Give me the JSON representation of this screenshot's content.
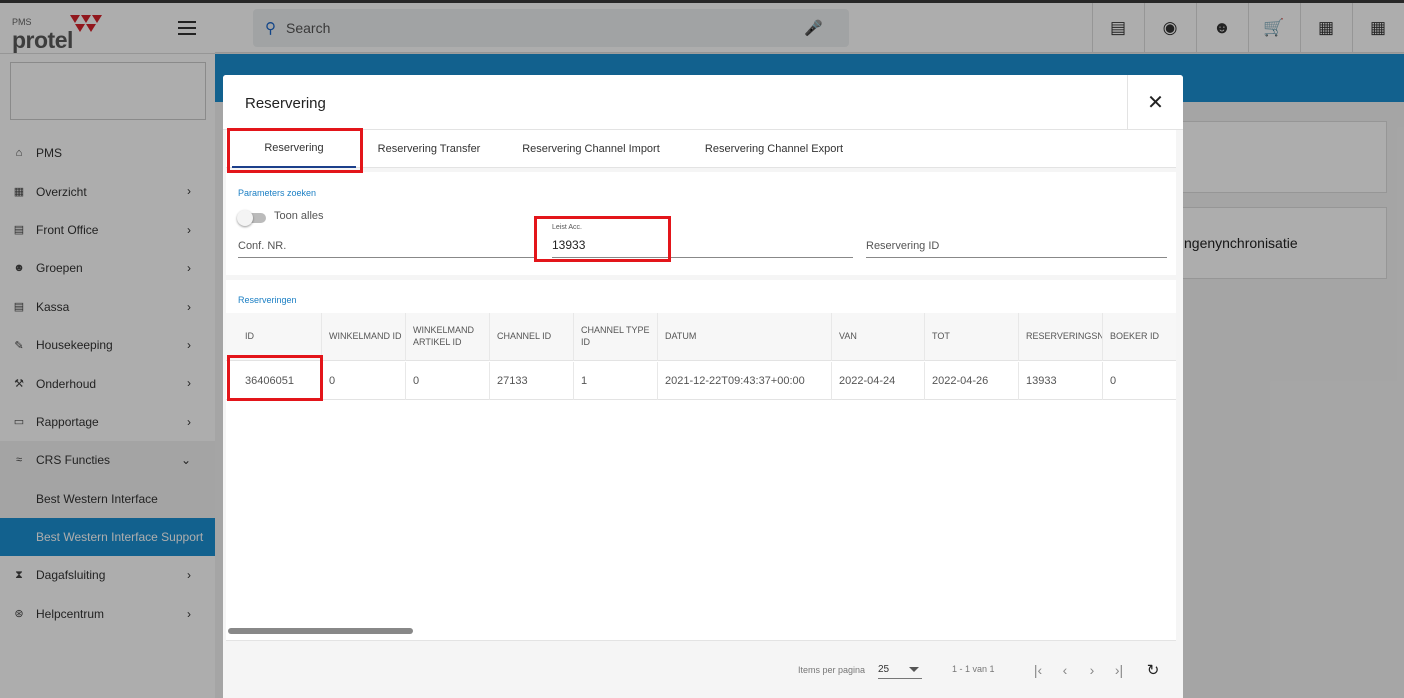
{
  "app": {
    "logo_small": "PMS",
    "logo_word": "protel"
  },
  "search": {
    "placeholder": "Search"
  },
  "sidebar": {
    "items": [
      {
        "label": "PMS",
        "icon": "home-icon"
      },
      {
        "label": "Overzicht",
        "icon": "dashboard-icon"
      },
      {
        "label": "Front Office",
        "icon": "desk-icon"
      },
      {
        "label": "Groepen",
        "icon": "group-icon"
      },
      {
        "label": "Kassa",
        "icon": "register-icon"
      },
      {
        "label": "Housekeeping",
        "icon": "brush-icon"
      },
      {
        "label": "Onderhoud",
        "icon": "wrench-icon"
      },
      {
        "label": "Rapportage",
        "icon": "report-icon"
      },
      {
        "label": "CRS Functies",
        "icon": "crs-icon"
      }
    ],
    "sub_items": [
      {
        "label": "Best Western Interface"
      },
      {
        "label": "Best Western Interface Support"
      }
    ],
    "bottom_items": [
      {
        "label": "Dagafsluiting",
        "icon": "hourglass-icon"
      },
      {
        "label": "Helpcentrum",
        "icon": "help-icon"
      }
    ]
  },
  "background": {
    "card_text": "ngenynchronisatie"
  },
  "dialog": {
    "title": "Reservering",
    "tabs": [
      {
        "label": "Reservering"
      },
      {
        "label": "Reservering Transfer"
      },
      {
        "label": "Reservering Channel Import"
      },
      {
        "label": "Reservering Channel Export"
      }
    ],
    "params": {
      "section_label": "Parameters zoeken",
      "toggle_label": "Toon alles",
      "conf_placeholder": "Conf. NR.",
      "leist_label": "Leist Acc.",
      "leist_value": "13933",
      "reservering_id_placeholder": "Reservering ID"
    },
    "results": {
      "section_label": "Reserveringen",
      "columns": [
        "ID",
        "WINKELMAND ID",
        "WINKELMAND ARTIKEL ID",
        "CHANNEL ID",
        "CHANNEL TYPE ID",
        "DATUM",
        "VAN",
        "TOT",
        "RESERVERINGSNUMMER",
        "BOEKER ID"
      ],
      "rows": [
        [
          "36406051",
          "0",
          "0",
          "27133",
          "1",
          "2021-12-22T09:43:37+00:00",
          "2022-04-24",
          "2022-04-26",
          "13933",
          "0"
        ]
      ]
    },
    "paginator": {
      "items_label": "Items per pagina",
      "page_size": "25",
      "range": "1 - 1 van 1"
    }
  }
}
